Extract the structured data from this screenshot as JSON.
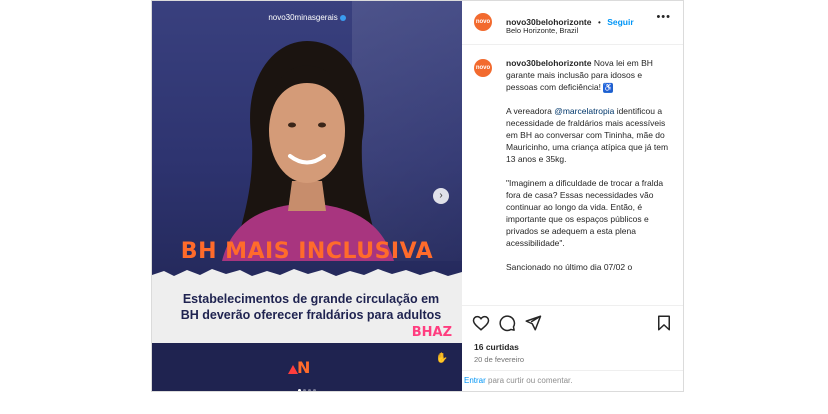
{
  "media": {
    "handle": "novo30minasgerais",
    "headline": "BH MAIS INCLUSIVA",
    "subtext_line1": "Estabelecimentos de grande circulação em",
    "subtext_line2": "BH deverão oferecer fraldários para adultos",
    "brand_bhaz": "BHAZ",
    "brand_n": "N"
  },
  "header": {
    "avatar_text": "novo",
    "username": "novo30belohorizonte",
    "separator": "•",
    "follow_label": "Seguir",
    "location": "Belo Horizonte, Brazil",
    "more_icon": "more-horizontal-icon"
  },
  "caption": {
    "avatar_text": "novo",
    "username": "novo30belohorizonte",
    "p1": "Nova lei em BH garante mais inclusão para idosos e pessoas com deficiência!",
    "wheelchair": "♿",
    "p2_pre": "A vereadora ",
    "mention": "@marcelatropia",
    "p2_post": " identificou a necessidade de fraldários mais acessíveis em BH ao conversar com Tininha, mãe do Mauricinho, uma criança atípica que já tem 13 anos e 35kg.",
    "p3": "\"Imaginem a dificuldade de trocar a fralda fora de casa? Essas necessidades vão continuar ao longo da vida. Então, é importante que os espaços públicos e privados se adequem a esta plena acessibilidade\".",
    "p4": "Sancionado no último dia 07/02 o"
  },
  "actions": {
    "likes": "16 curtidas",
    "date": "20 de fevereiro",
    "comment_prefix": "Entrar",
    "comment_rest": " para curtir ou comentar."
  },
  "colors": {
    "accent": "#0095f6",
    "headline": "#ff6b2b",
    "navy": "#1f2350"
  }
}
